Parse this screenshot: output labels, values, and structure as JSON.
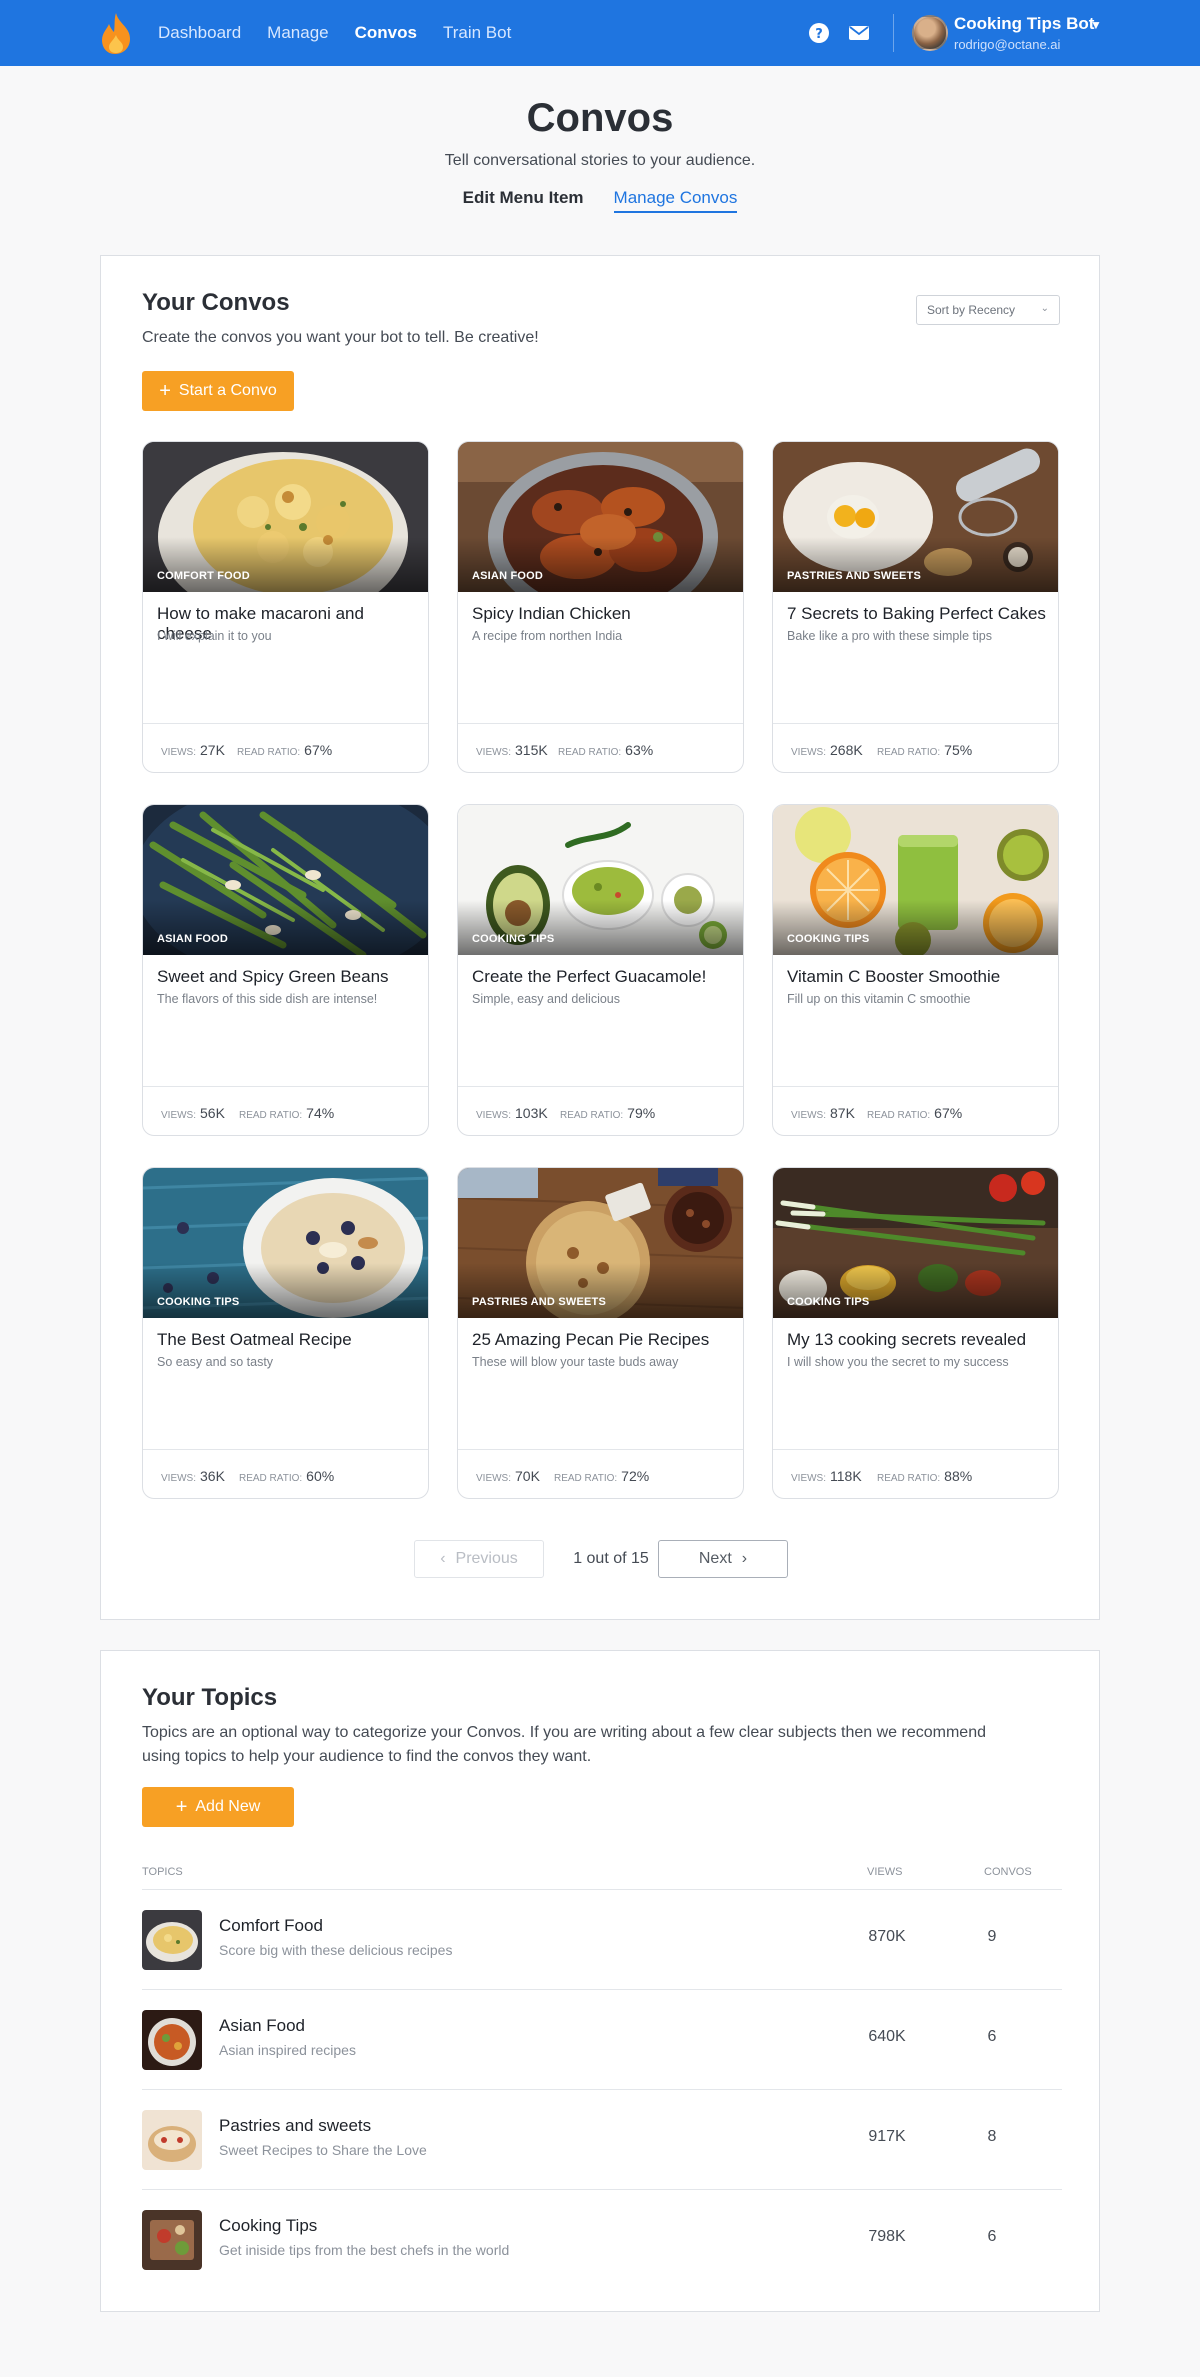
{
  "nav": {
    "links": [
      "Dashboard",
      "Manage",
      "Convos",
      "Train Bot"
    ],
    "active": "Convos",
    "account_name": "Cooking Tips Bot",
    "account_email": "rodrigo@octane.ai"
  },
  "page": {
    "title": "Convos",
    "subtitle": "Tell conversational stories to your audience.",
    "tabs": [
      "Edit Menu Item",
      "Manage Convos"
    ],
    "active_tab": "Manage Convos"
  },
  "convos": {
    "title": "Your Convos",
    "description": "Create the convos you want your bot to tell. Be creative!",
    "sort_label": "Sort by Recency",
    "start_button": "Start a Convo",
    "views_label": "VIEWS:",
    "ratio_label": "READ RATIO:",
    "cards": [
      {
        "category": "COMFORT FOOD",
        "title": "How to make macaroni and cheese",
        "subtitle": "I will explain it to you",
        "views": "27K",
        "ratio": "67%"
      },
      {
        "category": "ASIAN FOOD",
        "title": "Spicy Indian Chicken",
        "subtitle": "A recipe from northen India",
        "views": "315K",
        "ratio": "63%"
      },
      {
        "category": "PASTRIES AND SWEETS",
        "title": "7 Secrets to Baking Perfect Cakes",
        "subtitle": "Bake like a pro with these simple tips",
        "views": "268K",
        "ratio": "75%"
      },
      {
        "category": "ASIAN FOOD",
        "title": "Sweet and Spicy Green Beans",
        "subtitle": "The flavors of this side dish are intense!",
        "views": "56K",
        "ratio": "74%"
      },
      {
        "category": "COOKING TIPS",
        "title": "Create the Perfect Guacamole!",
        "subtitle": "Simple, easy and delicious",
        "views": "103K",
        "ratio": "79%"
      },
      {
        "category": "COOKING TIPS",
        "title": "Vitamin C Booster Smoothie",
        "subtitle": "Fill up on this vitamin C smoothie",
        "views": "87K",
        "ratio": "67%"
      },
      {
        "category": "COOKING TIPS",
        "title": "The Best Oatmeal Recipe",
        "subtitle": "So easy and so tasty",
        "views": "36K",
        "ratio": "60%"
      },
      {
        "category": "PASTRIES AND SWEETS",
        "title": "25 Amazing Pecan Pie Recipes",
        "subtitle": "These will blow your taste buds away",
        "views": "70K",
        "ratio": "72%"
      },
      {
        "category": "COOKING TIPS",
        "title": "My 13 cooking secrets revealed",
        "subtitle": "I will show you the secret to my success",
        "views": "118K",
        "ratio": "88%"
      }
    ],
    "pagination": {
      "previous": "Previous",
      "info": "1 out of 15",
      "next": "Next"
    }
  },
  "topics": {
    "title": "Your Topics",
    "description": "Topics are an optional way to categorize your Convos. If you are writing about a few clear subjects then we recommend using topics to help your audience to find the convos they want.",
    "add_button": "Add New",
    "headers": {
      "topics": "TOPICS",
      "views": "VIEWS",
      "convos": "CONVOS"
    },
    "rows": [
      {
        "name": "Comfort Food",
        "description": "Score big with these delicious recipes",
        "views": "870K",
        "convos": "9"
      },
      {
        "name": "Asian Food",
        "description": "Asian inspired recipes",
        "views": "640K",
        "convos": "6"
      },
      {
        "name": "Pastries and sweets",
        "description": "Sweet Recipes to Share the Love",
        "views": "917K",
        "convos": "8"
      },
      {
        "name": "Cooking Tips",
        "description": "Get iniside tips from the best chefs in the world",
        "views": "798K",
        "convos": "6"
      }
    ]
  },
  "colors": {
    "brand_blue": "#1f75e0",
    "accent_orange": "#f7a024"
  }
}
